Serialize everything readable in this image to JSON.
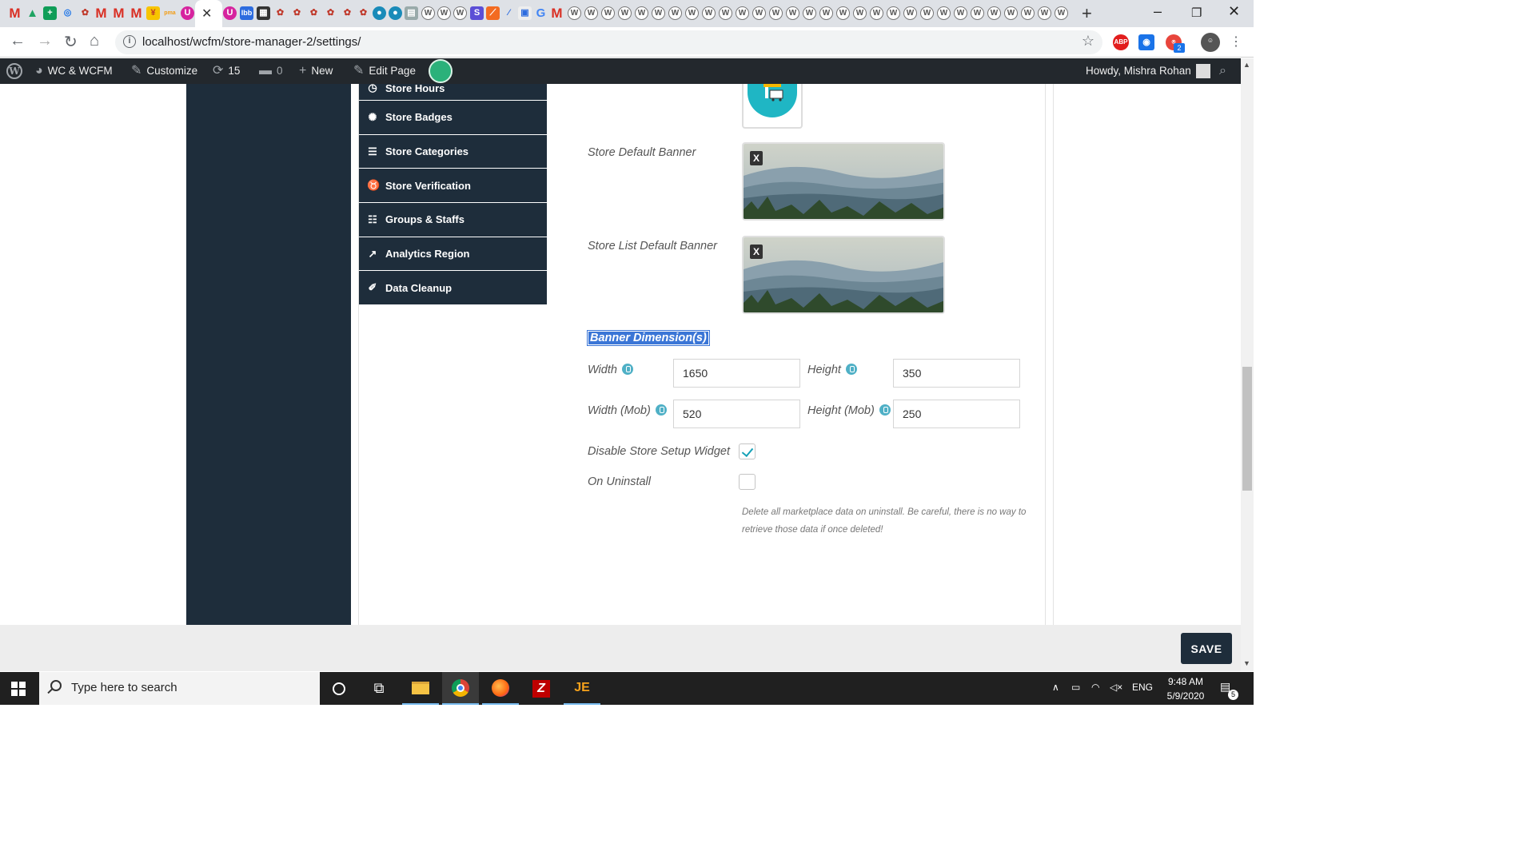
{
  "browser": {
    "url": "localhost/wcfm/store-manager-2/settings/",
    "tab_favicons": [
      "M",
      "▲",
      "+",
      "◎",
      "✿",
      "M",
      "M",
      "M",
      "¥",
      "pma",
      "U"
    ],
    "tab_close": "✕",
    "new_tab": "+",
    "extension_badge": "2",
    "abp_label": "ABP"
  },
  "adminbar": {
    "site": "WC & WCFM",
    "customize": "Customize",
    "updates": "15",
    "comments": "0",
    "new": "New",
    "edit_page": "Edit Page",
    "howdy": "Howdy, Mishra Rohan"
  },
  "menu": {
    "items": [
      {
        "label": "Store Hours",
        "icon": "clock-icon"
      },
      {
        "label": "Store Badges",
        "icon": "badge-icon"
      },
      {
        "label": "Store Categories",
        "icon": "layers-icon"
      },
      {
        "label": "Store Verification",
        "icon": "medal-icon"
      },
      {
        "label": "Groups & Staffs",
        "icon": "users-icon"
      },
      {
        "label": "Analytics Region",
        "icon": "chart-icon"
      },
      {
        "label": "Data Cleanup",
        "icon": "broom-icon"
      }
    ]
  },
  "settings": {
    "store_default_banner": "Store Default Banner",
    "store_list_default_banner": "Store List Default Banner",
    "banner_x": "X",
    "banner_dimensions": "Banner Dimension(s)",
    "width_label": "Width",
    "width_value": "1650",
    "height_label": "Height",
    "height_value": "350",
    "width_mob_label": "Width (Mob)",
    "width_mob_value": "520",
    "height_mob_label": "Height (Mob)",
    "height_mob_value": "250",
    "disable_setup_widget_label": "Disable Store Setup Widget",
    "disable_setup_widget_checked": true,
    "on_uninstall_label": "On Uninstall",
    "on_uninstall_checked": false,
    "uninstall_description": "Delete all marketplace data on uninstall. Be careful, there is no way to retrieve those data if once deleted!"
  },
  "footer": {
    "save_label": "SAVE"
  },
  "taskbar": {
    "search_placeholder": "Type here to search",
    "language": "ENG",
    "time": "9:48 AM",
    "date": "5/9/2020",
    "notification_count": "5"
  },
  "colors": {
    "menu_bg": "#1e2d3b",
    "adminbar_bg": "#23282d",
    "accent": "#17a2b8",
    "highlight": "#3b76d6"
  }
}
